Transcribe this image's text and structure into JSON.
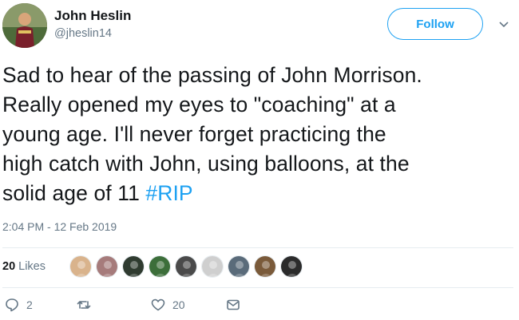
{
  "user": {
    "name": "John Heslin",
    "handle": "@jheslin14"
  },
  "follow_label": "Follow",
  "tweet": {
    "lines": [
      "Sad to hear of the passing of John Morrison.",
      "Really opened my eyes to \"coaching\" at a",
      "young age. I'll never forget practicing the",
      "high catch with John, using balloons, at the"
    ],
    "last_line_prefix": "solid age of 11 ",
    "hashtag": "#RIP"
  },
  "timestamp": "2:04 PM - 12 Feb 2019",
  "likes": {
    "count": "20",
    "label": "Likes",
    "avatar_colors": [
      "#d9b38c",
      "#a67b7b",
      "#2f3b30",
      "#3c6e3a",
      "#4a4a4a",
      "#cfcfcf",
      "#5a6b7a",
      "#7a5a3a",
      "#2b2b2b"
    ]
  },
  "actions": {
    "replies": "2",
    "likes": "20"
  },
  "colors": {
    "accent": "#1da1f2",
    "muted": "#657786"
  }
}
